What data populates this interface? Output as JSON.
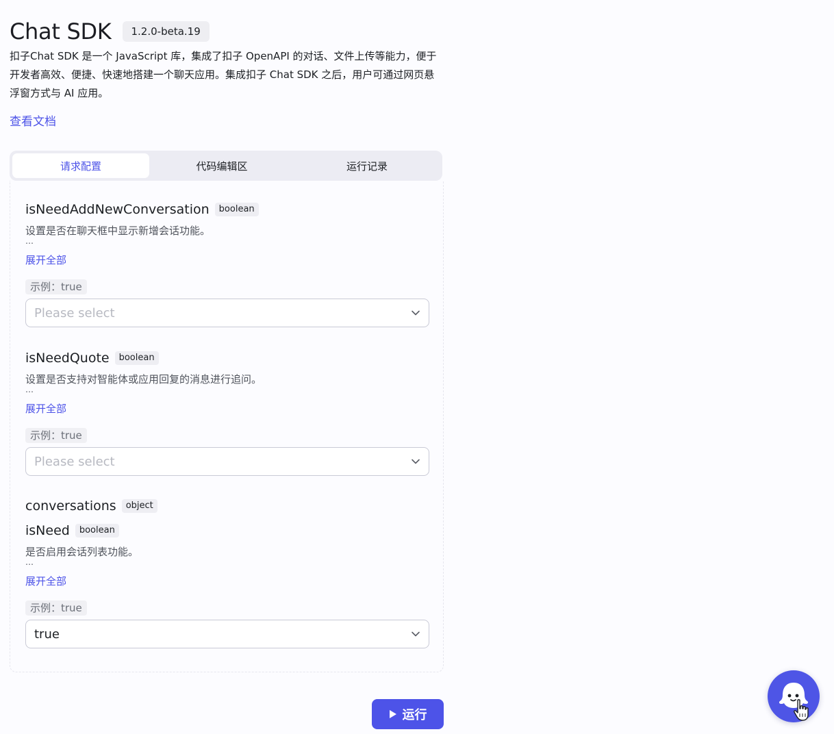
{
  "header": {
    "title": "Chat SDK",
    "version": "1.2.0-beta.19",
    "description": "扣子Chat SDK 是一个 JavaScript 库，集成了扣子 OpenAPI 的对话、文件上传等能力，便于开发者高效、便捷、快速地搭建一个聊天应用。集成扣子 Chat SDK 之后，用户可通过网页悬浮窗方式与 AI 应用。",
    "doc_link": "查看文档"
  },
  "tabs": [
    {
      "label": "请求配置",
      "active": true
    },
    {
      "label": "代码编辑区",
      "active": false
    },
    {
      "label": "运行记录",
      "active": false
    }
  ],
  "params": [
    {
      "name": "isNeedAddNewConversation",
      "type": "boolean",
      "description": "设置是否在聊天框中显示新增会话功能。",
      "ellipsis": "…",
      "expand_label": "展开全部",
      "example": "示例：true",
      "placeholder": "Please select",
      "value": ""
    },
    {
      "name": "isNeedQuote",
      "type": "boolean",
      "description": "设置是否支持对智能体或应用回复的消息进行追问。",
      "ellipsis": "…",
      "expand_label": "展开全部",
      "example": "示例：true",
      "placeholder": "Please select",
      "value": ""
    },
    {
      "name": "conversations",
      "type": "object"
    },
    {
      "name": "isNeed",
      "type": "boolean",
      "description": "是否启用会话列表功能。",
      "ellipsis": "…",
      "expand_label": "展开全部",
      "example": "示例：true",
      "placeholder": "Please select",
      "value": "true"
    }
  ],
  "run_button": {
    "label": "运行"
  },
  "colors": {
    "accent": "#4d53e8",
    "background": "#fcfcff"
  }
}
